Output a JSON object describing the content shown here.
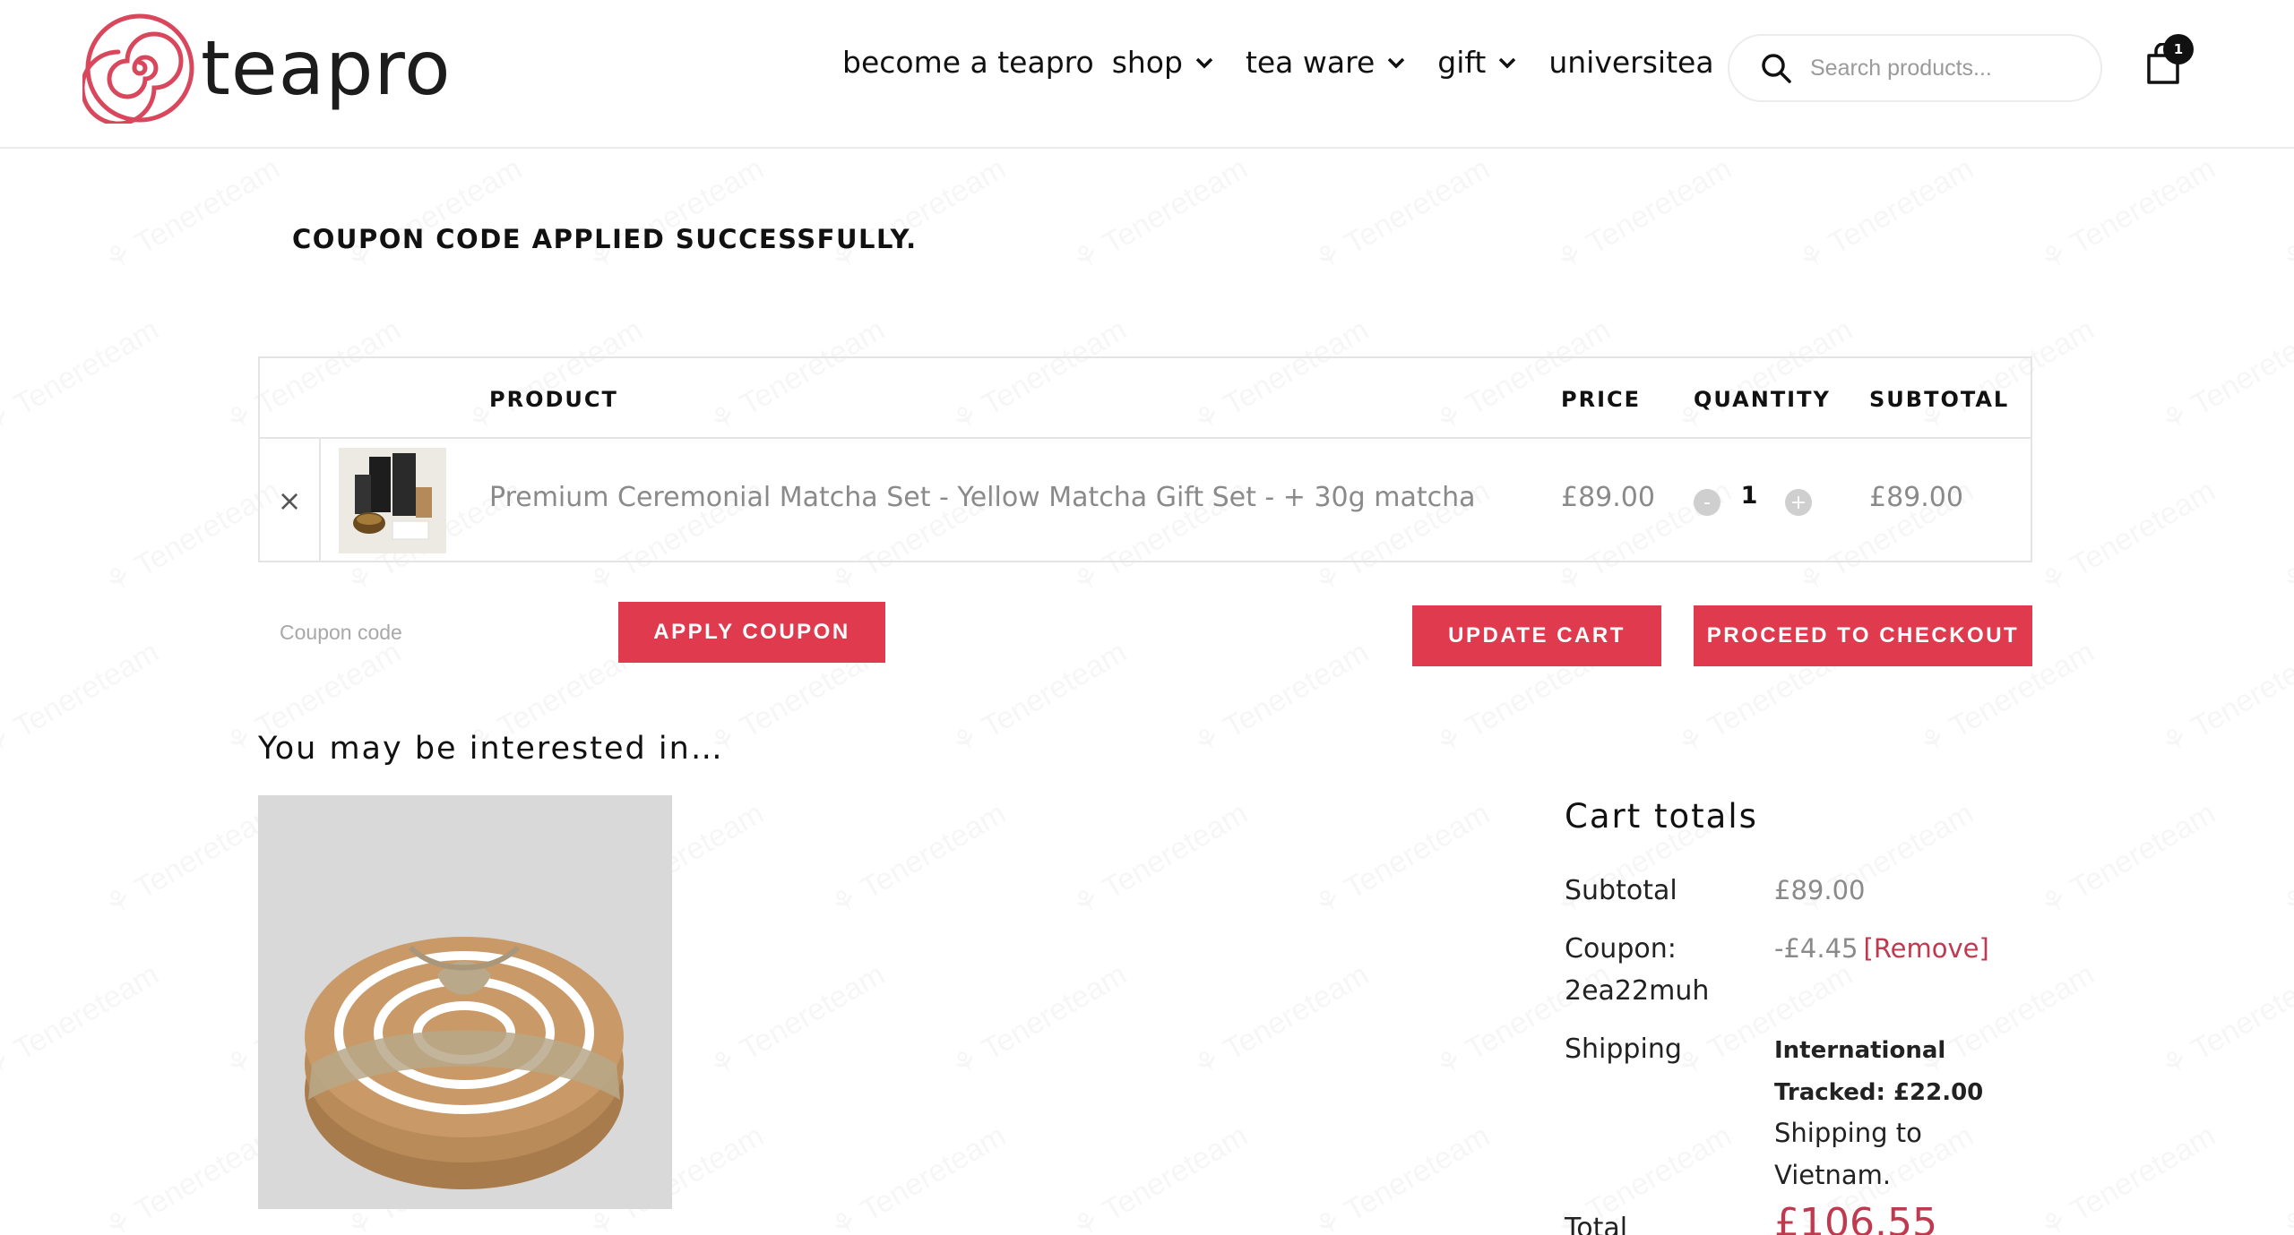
{
  "brand": {
    "name": "teapro",
    "accent": "#e03a4f",
    "logo_ring": "#d9475c"
  },
  "nav": {
    "items": [
      {
        "label": "become a teapro",
        "dropdown": false
      },
      {
        "label": "shop",
        "dropdown": true
      },
      {
        "label": "tea ware",
        "dropdown": true
      },
      {
        "label": "gift",
        "dropdown": true
      },
      {
        "label": "universitea",
        "dropdown": false
      }
    ]
  },
  "search": {
    "placeholder": "Search products..."
  },
  "cart": {
    "count": "1"
  },
  "notice": "COUPON CODE APPLIED SUCCESSFULLY.",
  "table": {
    "headers": {
      "product": "PRODUCT",
      "price": "PRICE",
      "quantity": "QUANTITY",
      "subtotal": "SUBTOTAL"
    },
    "rows": [
      {
        "remove": "×",
        "name": "Premium Ceremonial Matcha Set - Yellow Matcha Gift Set - + 30g matcha",
        "price": "£89.00",
        "qty_minus": "-",
        "quantity": "1",
        "qty_plus": "+",
        "subtotal": "£89.00"
      }
    ]
  },
  "actions": {
    "coupon_placeholder": "Coupon code",
    "apply": "APPLY COUPON",
    "update": "UPDATE CART",
    "checkout": "PROCEED TO CHECKOUT"
  },
  "interested": {
    "title": "You may be interested in…"
  },
  "totals": {
    "title": "Cart totals",
    "subtotal_label": "Subtotal",
    "subtotal_value": "£89.00",
    "coupon_label": "Coupon: 2ea22muh",
    "coupon_value": "-£4.45",
    "coupon_remove": "[Remove]",
    "shipping_label": "Shipping",
    "shipping_method": "International Tracked: £22.00",
    "shipping_to": "Shipping to Vietnam.",
    "total_label": "Total",
    "total_value": "£106.55"
  }
}
